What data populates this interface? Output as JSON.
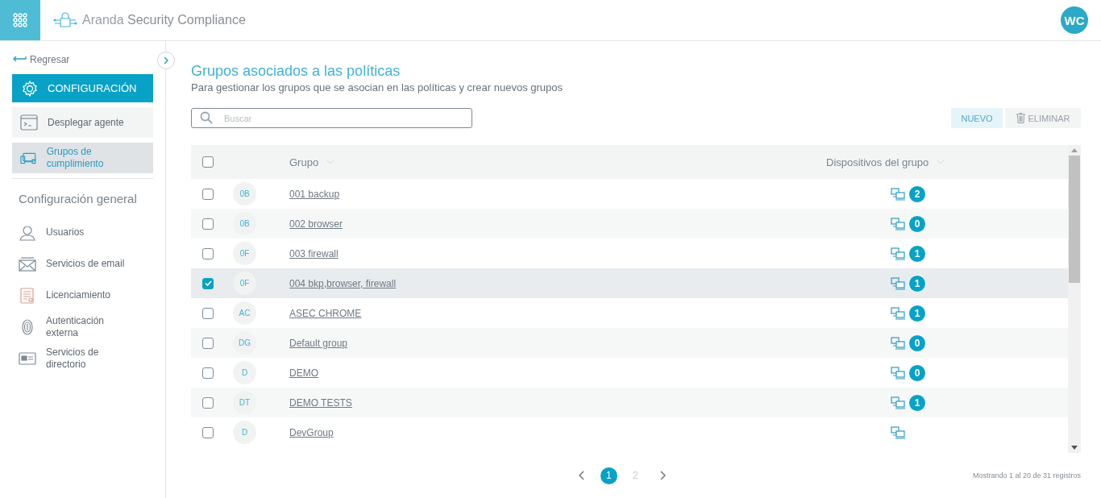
{
  "header": {
    "brand_light": "Aranda",
    "brand_bold": "Security Compliance",
    "avatar": "WC"
  },
  "sidebar": {
    "back": "Regresar",
    "section_button": "CONFIGURACIÓN",
    "items": [
      {
        "label": "Desplegar agente",
        "kind": "terminal",
        "selected": false
      },
      {
        "label": "Grupos de cumplimiento",
        "kind": "devices",
        "selected": true
      }
    ],
    "general_title": "Configuración general",
    "general_items": [
      {
        "label": "Usuarios",
        "kind": "user"
      },
      {
        "label": "Servicios de email",
        "kind": "mail"
      },
      {
        "label": "Licenciamiento",
        "kind": "license"
      },
      {
        "label": "Autenticación externa",
        "kind": "fingerprint"
      },
      {
        "label": "Servicios de directorio",
        "kind": "directory"
      }
    ]
  },
  "page": {
    "title": "Grupos asociados a las políticas",
    "subtitle": "Para gestionar los grupos que se asocian en las políticas y crear nuevos grupos"
  },
  "search": {
    "placeholder": "Buscar"
  },
  "buttons": {
    "new": "NUEVO",
    "delete": "ELIMINAR"
  },
  "table": {
    "columns": [
      "Grupo",
      "Dispositivos del grupo"
    ],
    "all_checked": false,
    "rows": [
      {
        "initials": "0B",
        "name": "001 backup",
        "count": "2",
        "checked": false
      },
      {
        "initials": "0B",
        "name": "002 browser",
        "count": "0",
        "checked": false
      },
      {
        "initials": "0F",
        "name": "003 firewall",
        "count": "1",
        "checked": false
      },
      {
        "initials": "0F",
        "name": "004 bkp,browser, firewall",
        "count": "1",
        "checked": true
      },
      {
        "initials": "AC",
        "name": "ASEC CHROME",
        "count": "1",
        "checked": false
      },
      {
        "initials": "DG",
        "name": "Default group",
        "count": "0",
        "checked": false
      },
      {
        "initials": "D",
        "name": "DEMO",
        "count": "0",
        "checked": false
      },
      {
        "initials": "DT",
        "name": "DEMO TESTS",
        "count": "1",
        "checked": false
      },
      {
        "initials": "D",
        "name": "DevGroup",
        "checked": false
      }
    ]
  },
  "pagination": {
    "pages": [
      {
        "label": "1",
        "selected": true
      },
      {
        "label": "2",
        "selected": false
      }
    ],
    "summary": "Mostrando 1 al 20 de 31 registros"
  }
}
